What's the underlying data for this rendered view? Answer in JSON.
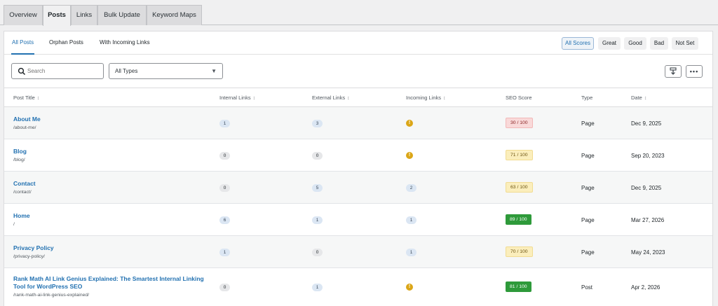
{
  "top_tabs": [
    {
      "label": "Overview"
    },
    {
      "label": "Posts"
    },
    {
      "label": "Links"
    },
    {
      "label": "Bulk Update"
    },
    {
      "label": "Keyword Maps"
    }
  ],
  "sub_tabs": [
    {
      "label": "All Posts"
    },
    {
      "label": "Orphan Posts"
    },
    {
      "label": "With Incoming Links"
    }
  ],
  "score_filters": [
    {
      "label": "All Scores"
    },
    {
      "label": "Great"
    },
    {
      "label": "Good"
    },
    {
      "label": "Bad"
    },
    {
      "label": "Not Set"
    }
  ],
  "search": {
    "placeholder": "Search",
    "icon": "search-icon"
  },
  "type_filter": {
    "selected": "All Types",
    "icon": "chevron-down-icon"
  },
  "toolbar_icons": [
    "export-icon",
    "more-options-icon"
  ],
  "columns": {
    "post_title": "Post Title",
    "internal_links": "Internal Links",
    "external_links": "External Links",
    "incoming_links": "Incoming Links",
    "seo_score": "SEO Score",
    "type": "Type",
    "date": "Date"
  },
  "rows": [
    {
      "title": "About Me",
      "slug": "/about-me/",
      "internal": "1",
      "external": "3",
      "incoming": "!",
      "seo": "30 / 100",
      "seo_level": "bad",
      "type": "Page",
      "date": "Dec 9, 2025"
    },
    {
      "title": "Blog",
      "slug": "/blog/",
      "internal": "0",
      "external": "0",
      "incoming": "!",
      "seo": "71 / 100",
      "seo_level": "ok",
      "type": "Page",
      "date": "Sep 20, 2023"
    },
    {
      "title": "Contact",
      "slug": "/contact/",
      "internal": "0",
      "external": "5",
      "incoming": "2",
      "seo": "63 / 100",
      "seo_level": "ok",
      "type": "Page",
      "date": "Dec 9, 2025"
    },
    {
      "title": "Home",
      "slug": "/",
      "internal": "6",
      "external": "1",
      "incoming": "1",
      "seo": "89 / 100",
      "seo_level": "good",
      "type": "Page",
      "date": "Mar 27, 2026"
    },
    {
      "title": "Privacy Policy",
      "slug": "/privacy-policy/",
      "internal": "1",
      "external": "0",
      "incoming": "1",
      "seo": "70 / 100",
      "seo_level": "ok",
      "type": "Page",
      "date": "May 24, 2023"
    },
    {
      "title_line1": "Rank Math AI Link Genius Explained: The Smartest Internal Linking",
      "title_line2": "Tool for WordPress SEO",
      "slug": "/rank-math-ai-link-genius-explained/",
      "internal": "0",
      "external": "1",
      "incoming": "!",
      "seo": "81 / 100",
      "seo_level": "good",
      "type": "Post",
      "date": "Apr 2, 2026"
    }
  ],
  "colors": {
    "accent": "#2271b1",
    "bad": "#f9d9d9",
    "ok": "#fbeebc",
    "good": "#2e9a3a",
    "warning": "#dba617"
  }
}
